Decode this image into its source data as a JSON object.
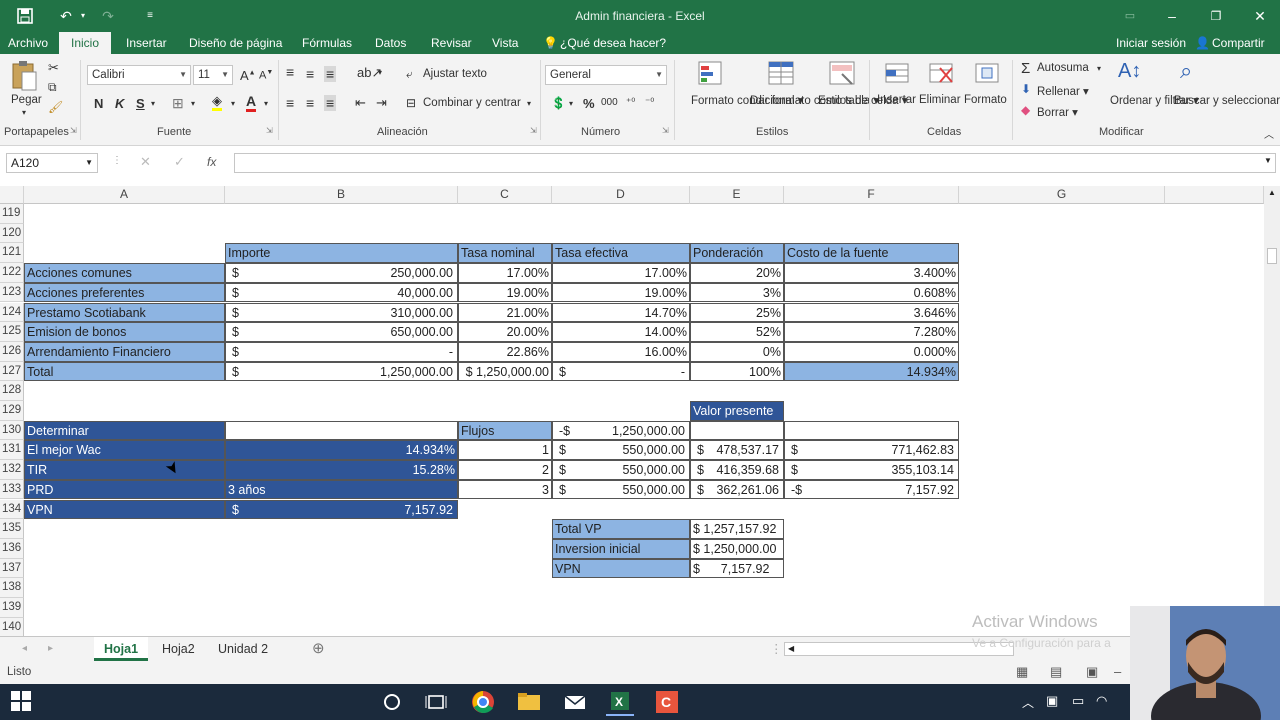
{
  "window": {
    "title": "Admin financiera - Excel"
  },
  "menu": {
    "tabs": [
      "Archivo",
      "Inicio",
      "Insertar",
      "Diseño de página",
      "Fórmulas",
      "Datos",
      "Revisar",
      "Vista"
    ],
    "tell_me": "¿Qué desea hacer?",
    "sign_in": "Iniciar sesión",
    "share": "Compartir"
  },
  "ribbon": {
    "clipboard": {
      "paste": "Pegar",
      "label": "Portapapeles"
    },
    "font": {
      "name": "Calibri",
      "size": "11",
      "bold": "N",
      "italic": "K",
      "underline": "S",
      "label": "Fuente"
    },
    "alignment": {
      "wrap": "Ajustar texto",
      "merge": "Combinar y centrar",
      "label": "Alineación"
    },
    "number": {
      "format": "General",
      "percent": "%",
      "thousands": "000",
      "label": "Número"
    },
    "styles": {
      "conditional": "Formato condicional",
      "as_table": "Dar formato como tabla",
      "cell_styles": "Estilos de celda",
      "label": "Estilos"
    },
    "cells": {
      "insert": "Insertar",
      "delete": "Eliminar",
      "format": "Formato",
      "label": "Celdas"
    },
    "editing": {
      "autosum": "Autosuma",
      "fill": "Rellenar",
      "clear": "Borrar",
      "sort": "Ordenar y filtrar",
      "find": "Buscar y seleccionar",
      "label": "Modificar"
    }
  },
  "formula_bar": {
    "name_box": "A120",
    "fx": "fx",
    "content": ""
  },
  "columns": [
    "A",
    "B",
    "C",
    "D",
    "E",
    "F",
    "G"
  ],
  "rows": [
    "119",
    "120",
    "121",
    "122",
    "123",
    "124",
    "125",
    "126",
    "127",
    "128",
    "129",
    "130",
    "131",
    "132",
    "133",
    "134",
    "135",
    "136",
    "137",
    "138",
    "139",
    "140"
  ],
  "table1": {
    "headers": {
      "importe": "Importe",
      "tasa_nominal": "Tasa nominal",
      "tasa_efectiva": "Tasa efectiva",
      "ponderacion": "Ponderación",
      "costo": "Costo de la fuente"
    },
    "rows": [
      {
        "name": "Acciones comunes",
        "cur": "$",
        "importe": "250,000.00",
        "nominal": "17.00%",
        "efectiva": "17.00%",
        "pond": "20%",
        "costo": "3.400%"
      },
      {
        "name": "Acciones preferentes",
        "cur": "$",
        "importe": "40,000.00",
        "nominal": "19.00%",
        "efectiva": "19.00%",
        "pond": "3%",
        "costo": "0.608%"
      },
      {
        "name": "Prestamo Scotiabank",
        "cur": "$",
        "importe": "310,000.00",
        "nominal": "21.00%",
        "efectiva": "14.70%",
        "pond": "25%",
        "costo": "3.646%"
      },
      {
        "name": "Emision de bonos",
        "cur": "$",
        "importe": "650,000.00",
        "nominal": "20.00%",
        "efectiva": "14.00%",
        "pond": "52%",
        "costo": "7.280%"
      },
      {
        "name": "Arrendamiento Financiero",
        "cur": "$",
        "importe": "-",
        "nominal": "22.86%",
        "efectiva": "16.00%",
        "pond": "0%",
        "costo": "0.000%"
      }
    ],
    "total": {
      "name": "Total",
      "cur": "$",
      "importe": "1,250,000.00",
      "nominal": "$ 1,250,000.00",
      "efectiva_cur": "$",
      "efectiva": "-",
      "pond": "100%",
      "costo": "14.934%"
    }
  },
  "table2": {
    "rows": [
      {
        "label": "Determinar",
        "value": ""
      },
      {
        "label": "El mejor Wac",
        "value": "14.934%"
      },
      {
        "label": "TIR",
        "value": "15.28%"
      },
      {
        "label": "PRD",
        "value": "3 años"
      },
      {
        "label": "VPN",
        "cur": "$",
        "value": "7,157.92"
      }
    ]
  },
  "flows": {
    "header": "Flujos",
    "valor_presente": "Valor presente",
    "initial": {
      "cur": "-$",
      "value": "1,250,000.00"
    },
    "rows": [
      {
        "n": "1",
        "cur": "$",
        "flow": "550,000.00",
        "pv_cur": "$",
        "pv": "478,537.17",
        "f_cur": "$",
        "f": "771,462.83"
      },
      {
        "n": "2",
        "cur": "$",
        "flow": "550,000.00",
        "pv_cur": "$",
        "pv": "416,359.68",
        "f_cur": "$",
        "f": "355,103.14"
      },
      {
        "n": "3",
        "cur": "$",
        "flow": "550,000.00",
        "pv_cur": "$",
        "pv": "362,261.06",
        "f_cur": "-$",
        "f": "7,157.92"
      }
    ]
  },
  "summary": [
    {
      "label": "Total VP",
      "value": "$ 1,257,157.92"
    },
    {
      "label": "Inversion inicial",
      "value": "$ 1,250,000.00"
    },
    {
      "label": "VPN",
      "value": "$      7,157.92"
    }
  ],
  "sheet_tabs": [
    "Hoja1",
    "Hoja2",
    "Unidad 2"
  ],
  "status": {
    "ready": "Listo"
  },
  "watermark": {
    "line1": "Activar Windows",
    "line2": "Ve a Configuración para a"
  },
  "colors": {
    "excel_green": "#217346",
    "light_blue": "#8db4e2",
    "dark_blue": "#2f5597"
  }
}
